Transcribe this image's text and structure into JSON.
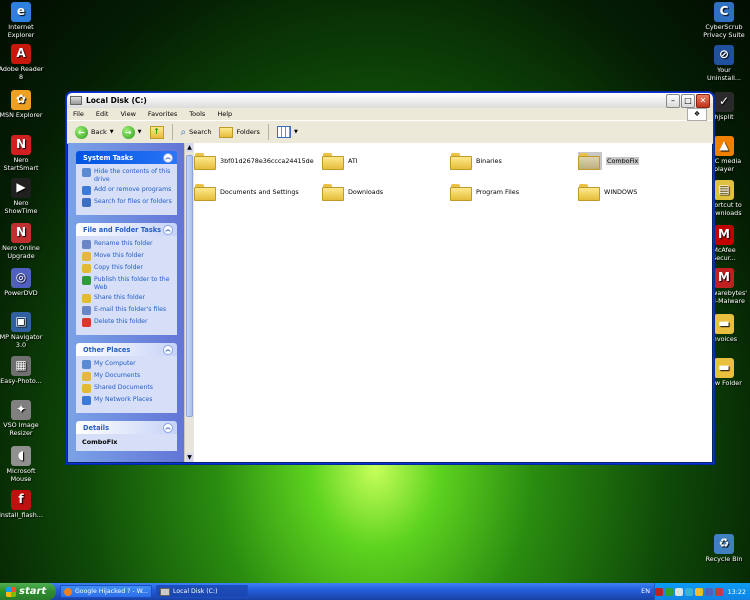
{
  "desktop_left": [
    {
      "label": "Internet Explorer",
      "icon": "ie-icon",
      "glyph": "e",
      "color": "#2f7fe0"
    },
    {
      "label": "Adobe Reader 8",
      "icon": "adobe-reader-icon",
      "glyph": "A",
      "color": "#c8180c"
    },
    {
      "label": "MSN Explorer",
      "icon": "msn-butterfly-icon",
      "glyph": "✿",
      "color": "#f0a020"
    },
    {
      "label": "Nero StartSmart",
      "icon": "nero-icon",
      "glyph": "N",
      "color": "#d02020"
    },
    {
      "label": "Nero ShowTime",
      "icon": "nero-showtime-icon",
      "glyph": "▶",
      "color": "#202020"
    },
    {
      "label": "Nero Online Upgrade",
      "icon": "nero-upgrade-icon",
      "glyph": "N",
      "color": "#c03030"
    },
    {
      "label": "PowerDVD",
      "icon": "powerdvd-icon",
      "glyph": "◎",
      "color": "#5060c0"
    },
    {
      "label": "MP Navigator 3.0",
      "icon": "mp-navigator-icon",
      "glyph": "▣",
      "color": "#3060a0"
    },
    {
      "label": "Easy-Photo...",
      "icon": "easy-photo-icon",
      "glyph": "▦",
      "color": "#707070"
    },
    {
      "label": "VSO Image Resizer",
      "icon": "vso-resizer-icon",
      "glyph": "✦",
      "color": "#808080"
    },
    {
      "label": "Microsoft Mouse",
      "icon": "mouse-icon",
      "glyph": "◖",
      "color": "#909090"
    },
    {
      "label": "install_flash...",
      "icon": "flash-installer-icon",
      "glyph": "f",
      "color": "#c01010"
    }
  ],
  "desktop_right": [
    {
      "label": "CyberScrub Privacy Suite",
      "icon": "cyberscrub-icon",
      "glyph": "C",
      "color": "#3070c0"
    },
    {
      "label": "Your Uninstall...",
      "icon": "uninstaller-icon",
      "glyph": "⊘",
      "color": "#2050a0"
    },
    {
      "label": "hjsplit",
      "icon": "hjsplit-icon",
      "glyph": "✓",
      "color": "#2a2a2a"
    },
    {
      "label": "VLC media player",
      "icon": "vlc-cone-icon",
      "glyph": "▲",
      "color": "#f08000"
    },
    {
      "label": "Shortcut to Downloads",
      "icon": "downloads-shortcut-icon",
      "glyph": "▤",
      "color": "#e0c040"
    },
    {
      "label": "McAfee Secur...",
      "icon": "mcafee-icon",
      "glyph": "M",
      "color": "#c00000"
    },
    {
      "label": "Malwarebytes' Anti-Malware",
      "icon": "malwarebytes-icon",
      "glyph": "M",
      "color": "#c02020"
    },
    {
      "label": "Invoices",
      "icon": "folder-icon",
      "glyph": "▬",
      "color": "#e8c040"
    },
    {
      "label": "New Folder",
      "icon": "folder-icon",
      "glyph": "▬",
      "color": "#e8c040"
    },
    {
      "label": "Recycle Bin",
      "icon": "recycle-bin-icon",
      "glyph": "♻",
      "color": "#4080c0"
    }
  ],
  "window": {
    "title": "Local Disk (C:)",
    "menu": [
      "File",
      "Edit",
      "View",
      "Favorites",
      "Tools",
      "Help"
    ],
    "toolbar": {
      "back": "Back",
      "search": "Search",
      "folders": "Folders"
    }
  },
  "panels": {
    "system_tasks": {
      "title": "System Tasks",
      "items": [
        {
          "label": "Hide the contents of this drive",
          "icon": "hide-contents-icon",
          "color": "#5a8ad6"
        },
        {
          "label": "Add or remove programs",
          "icon": "add-remove-icon",
          "color": "#3c7ad8"
        },
        {
          "label": "Search for files or folders",
          "icon": "search-icon",
          "color": "#3f6fc2"
        }
      ]
    },
    "file_folder_tasks": {
      "title": "File and Folder Tasks",
      "items": [
        {
          "label": "Rename this folder",
          "icon": "rename-icon",
          "color": "#6a86c6"
        },
        {
          "label": "Move this folder",
          "icon": "move-icon",
          "color": "#e6b83a"
        },
        {
          "label": "Copy this folder",
          "icon": "copy-icon",
          "color": "#e6b83a"
        },
        {
          "label": "Publish this folder to the Web",
          "icon": "publish-web-icon",
          "color": "#2f9a3a"
        },
        {
          "label": "Share this folder",
          "icon": "share-icon",
          "color": "#e6b83a"
        },
        {
          "label": "E-mail this folder's files",
          "icon": "email-icon",
          "color": "#6a86c6"
        },
        {
          "label": "Delete this folder",
          "icon": "delete-icon",
          "color": "#d63a2a"
        }
      ]
    },
    "other_places": {
      "title": "Other Places",
      "items": [
        {
          "label": "My Computer",
          "icon": "my-computer-icon",
          "color": "#5a8ad6"
        },
        {
          "label": "My Documents",
          "icon": "my-documents-icon",
          "color": "#e6b83a"
        },
        {
          "label": "Shared Documents",
          "icon": "shared-documents-icon",
          "color": "#e6b83a"
        },
        {
          "label": "My Network Places",
          "icon": "network-places-icon",
          "color": "#3c7ad8"
        }
      ]
    },
    "details": {
      "title": "Details",
      "first": "ComboFix"
    }
  },
  "folders": [
    {
      "name": "3bf01d2678e36ccca24415de",
      "selected": false
    },
    {
      "name": "ATI",
      "selected": false
    },
    {
      "name": "Binaries",
      "selected": false
    },
    {
      "name": "ComboFix",
      "selected": true
    },
    {
      "name": "Documents and Settings",
      "selected": false
    },
    {
      "name": "Downloads",
      "selected": false
    },
    {
      "name": "Program Files",
      "selected": false
    },
    {
      "name": "WINDOWS",
      "selected": false
    }
  ],
  "taskbar": {
    "start": "start",
    "buttons": [
      {
        "label": "Google Hijacked ? - W...",
        "active": false
      },
      {
        "label": "Local Disk (C:)",
        "active": true
      }
    ],
    "lang": "EN",
    "clock": "13:22"
  }
}
